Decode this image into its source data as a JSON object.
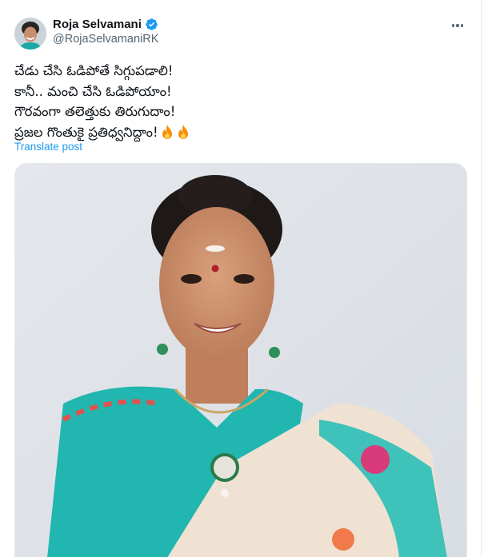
{
  "author": {
    "display_name": "Roja Selvamani",
    "handle": "@RojaSelvamaniRK",
    "verified": true,
    "verified_color": "#1d9bf0"
  },
  "tweet": {
    "lines": [
      "చేడు చేసి ఓడిపోతే సిగ్గుపడాలి!",
      "కానీ.. మంచి చేసి ఓడిపోయాం!",
      "గౌరవంగా తలెత్తుకు తిరుగుదాం!",
      "ప్రజల గొంతుకై ప్రతిధ్వనిద్దాం!"
    ],
    "trailing_emoji": [
      "fire-icon",
      "fire-icon"
    ],
    "translate_label": "Translate post"
  },
  "icons": {
    "verified": "verified-badge-icon",
    "more": "more-options-icon",
    "fire": "fire-icon"
  },
  "colors": {
    "link": "#1d9bf0",
    "secondary_text": "#536471",
    "primary_text": "#0f1419"
  }
}
